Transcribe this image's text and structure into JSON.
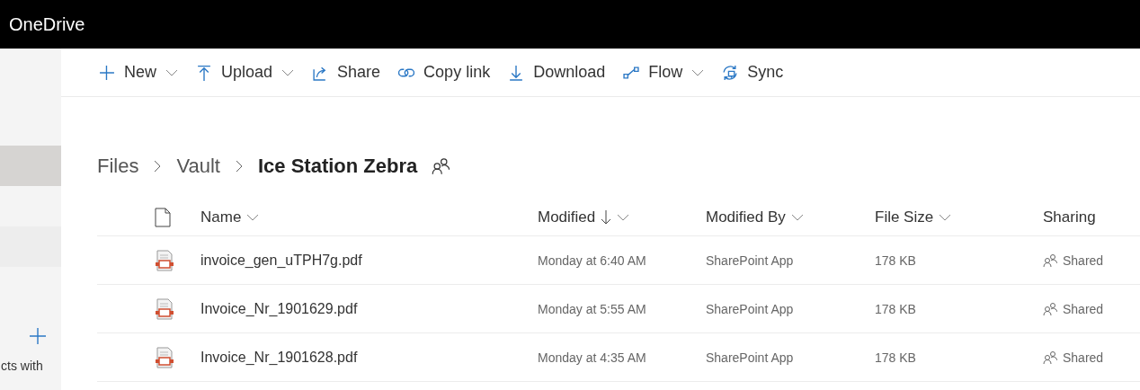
{
  "app": {
    "title": "OneDrive"
  },
  "sidebar": {
    "items": [
      {
        "selected": true
      },
      {
        "selected": false
      }
    ],
    "add_label": "cts with"
  },
  "toolbar": [
    {
      "kind": "new",
      "label": "New",
      "menu": true
    },
    {
      "kind": "upload",
      "label": "Upload",
      "menu": true
    },
    {
      "kind": "share",
      "label": "Share",
      "menu": false
    },
    {
      "kind": "link",
      "label": "Copy link",
      "menu": false
    },
    {
      "kind": "download",
      "label": "Download",
      "menu": false
    },
    {
      "kind": "flow",
      "label": "Flow",
      "menu": true
    },
    {
      "kind": "sync",
      "label": "Sync",
      "menu": false
    }
  ],
  "breadcrumb": {
    "items": [
      "Files",
      "Vault",
      "Ice Station Zebra"
    ],
    "shared": true
  },
  "table": {
    "columns": [
      {
        "label": "Name",
        "menu": true,
        "sorted": false
      },
      {
        "label": "Modified",
        "menu": true,
        "sorted": true
      },
      {
        "label": "Modified By",
        "menu": true,
        "sorted": false
      },
      {
        "label": "File Size",
        "menu": true,
        "sorted": false
      },
      {
        "label": "Sharing",
        "menu": false,
        "sorted": false
      }
    ],
    "rows": [
      {
        "name": "invoice_gen_uTPH7g.pdf",
        "modified": "Monday at 6:40 AM",
        "modified_by": "SharePoint App",
        "size": "178 KB",
        "sharing": "Shared"
      },
      {
        "name": "Invoice_Nr_1901629.pdf",
        "modified": "Monday at 5:55 AM",
        "modified_by": "SharePoint App",
        "size": "178 KB",
        "sharing": "Shared"
      },
      {
        "name": "Invoice_Nr_1901628.pdf",
        "modified": "Monday at 4:35 AM",
        "modified_by": "SharePoint App",
        "size": "178 KB",
        "sharing": "Shared"
      }
    ]
  }
}
